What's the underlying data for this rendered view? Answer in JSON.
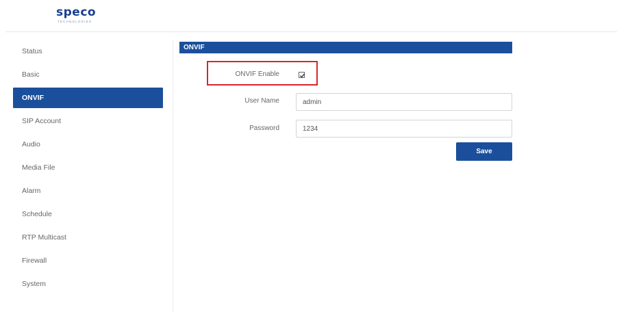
{
  "logo": {
    "brand": "speco",
    "tagline": "TECHNOLOGIES"
  },
  "sidebar": {
    "items": [
      {
        "label": "Status"
      },
      {
        "label": "Basic"
      },
      {
        "label": "ONVIF",
        "active": true
      },
      {
        "label": "SIP Account"
      },
      {
        "label": "Audio"
      },
      {
        "label": "Media File"
      },
      {
        "label": "Alarm"
      },
      {
        "label": "Schedule"
      },
      {
        "label": "RTP Multicast"
      },
      {
        "label": "Firewall"
      },
      {
        "label": "System"
      }
    ]
  },
  "main": {
    "section_title": "ONVIF",
    "onvif_enable": {
      "label": "ONVIF Enable",
      "checked": true
    },
    "username": {
      "label": "User Name",
      "value": "admin"
    },
    "password": {
      "label": "Password",
      "value": "1234"
    },
    "save_label": "Save"
  },
  "colors": {
    "accent": "#1b4f9c",
    "highlight": "#d9252a",
    "brand": "#1a3f8f"
  },
  "icons": {
    "checkbox": "checkmark-icon"
  }
}
